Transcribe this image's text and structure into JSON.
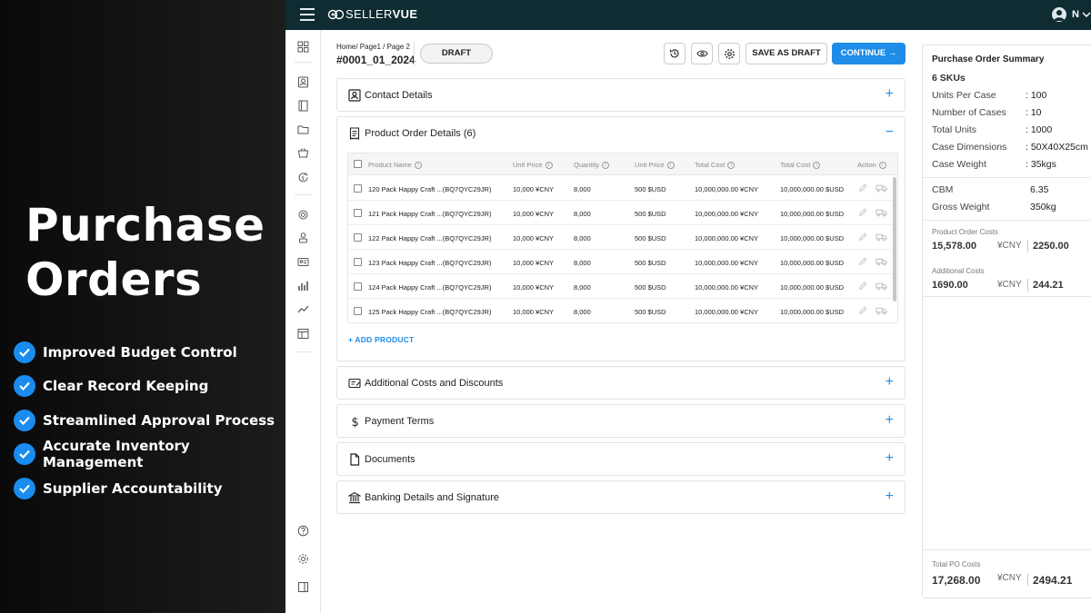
{
  "promo": {
    "title_line1": "Purchase",
    "title_line2": "Orders",
    "benefits": [
      "Improved Budget Control",
      "Clear Record Keeping",
      "Streamlined Approval Process",
      "Accurate Inventory Management",
      "Supplier Accountability"
    ]
  },
  "app": {
    "logo_light": "SELLER",
    "logo_bold": "VUE",
    "user_initial": "N"
  },
  "header": {
    "breadcrumb": "Home/ Page1 / Page 2",
    "po_number": "#0001_01_2024",
    "status": "DRAFT",
    "save_draft_label": "SAVE AS DRAFT",
    "continue_label": "CONTINUE →"
  },
  "sections": {
    "contact": "Contact Details",
    "product": "Product Order Details (6)",
    "additional": "Additional Costs and Discounts",
    "payment": "Payment Terms",
    "documents": "Documents",
    "banking": "Banking Details and Signature",
    "expand_symbol": "+",
    "collapse_symbol": "−"
  },
  "table": {
    "columns": [
      "Product Name",
      "Unit Price",
      "Quantity",
      "Unit Price",
      "Total Cost",
      "Total Cost",
      "Action"
    ],
    "rows": [
      {
        "name": "120 Pack Happy Craft ...(BQ7QYC29JR)",
        "unit_price_cny": "10,000 ¥CNY",
        "qty": "8,000",
        "unit_price_usd": "500 $USD",
        "total_cny": "10,000,000.00 ¥CNY",
        "total_usd": "10,000,000.00 $USD"
      },
      {
        "name": "121 Pack Happy Craft ...(BQ7QYC29JR)",
        "unit_price_cny": "10,000 ¥CNY",
        "qty": "8,000",
        "unit_price_usd": "500 $USD",
        "total_cny": "10,000,000.00 ¥CNY",
        "total_usd": "10,000,000.00 $USD"
      },
      {
        "name": "122 Pack Happy Craft ...(BQ7QYC29JR)",
        "unit_price_cny": "10,000 ¥CNY",
        "qty": "8,000",
        "unit_price_usd": "500 $USD",
        "total_cny": "10,000,000.00 ¥CNY",
        "total_usd": "10,000,000.00 $USD"
      },
      {
        "name": "123 Pack Happy Craft ...(BQ7QYC29JR)",
        "unit_price_cny": "10,000 ¥CNY",
        "qty": "8,000",
        "unit_price_usd": "500 $USD",
        "total_cny": "10,000,000.00 ¥CNY",
        "total_usd": "10,000,000.00 $USD"
      },
      {
        "name": "124 Pack Happy Craft ...(BQ7QYC29JR)",
        "unit_price_cny": "10,000 ¥CNY",
        "qty": "8,000",
        "unit_price_usd": "500 $USD",
        "total_cny": "10,000,000.00 ¥CNY",
        "total_usd": "10,000,000.00 $USD"
      },
      {
        "name": "125 Pack Happy Craft ...(BQ7QYC29JR)",
        "unit_price_cny": "10,000 ¥CNY",
        "qty": "8,000",
        "unit_price_usd": "500 $USD",
        "total_cny": "10,000,000.00 ¥CNY",
        "total_usd": "10,000,000.00 $USD"
      }
    ],
    "add_product_label": "+ ADD PRODUCT"
  },
  "summary": {
    "title": "Purchase Order Summary",
    "skus": "6 SKUs",
    "specs": [
      {
        "label": "Units Per Case",
        "value": ": 100"
      },
      {
        "label": "Number of Cases",
        "value": ": 10"
      },
      {
        "label": "Total Units",
        "value": ": 1000"
      },
      {
        "label": "Case Dimensions",
        "value": ": 50X40X25cm"
      },
      {
        "label": "Case Weight",
        "value": ": 35kgs"
      }
    ],
    "cbm_label": "CBM",
    "cbm_value": "6.35",
    "gross_label": "Gross Weight",
    "gross_value": "350kg",
    "product_costs_label": "Product Order Costs",
    "product_costs_cny": "15,578.00",
    "product_costs_currency": "¥CNY",
    "product_costs_usd": "2250.00",
    "additional_costs_label": "Additional Costs",
    "additional_costs_cny": "1690.00",
    "additional_costs_currency": "¥CNY",
    "additional_costs_usd": "244.21",
    "total_label": "Total PO Costs",
    "total_cny": "17,268.00",
    "total_currency": "¥CNY",
    "total_usd": "2494.21"
  },
  "colors": {
    "accent": "#1f8de8",
    "topbar": "#0e2c31",
    "check": "#1a8cf0"
  }
}
